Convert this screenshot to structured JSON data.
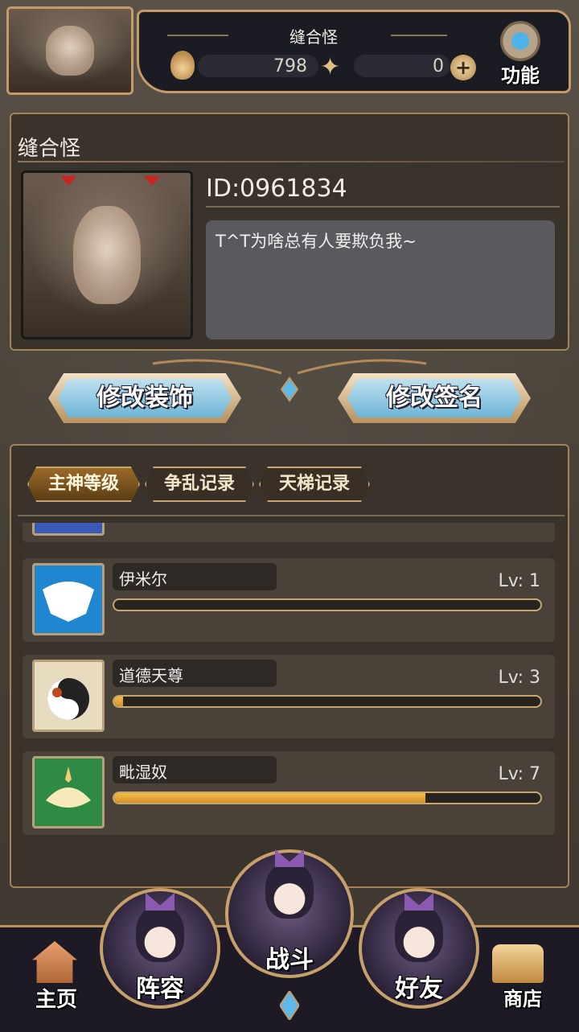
{
  "header": {
    "player_name": "缝合怪",
    "currency_1": "798",
    "currency_2": "0",
    "function_label": "功能"
  },
  "profile": {
    "name": "缝合怪",
    "id_text": "ID:0961834",
    "signature": "T^T为啥总有人要欺负我~"
  },
  "actions": {
    "edit_decoration": "修改装饰",
    "edit_signature": "修改签名"
  },
  "tabs": [
    {
      "label": "主神等级",
      "active": true
    },
    {
      "label": "争乱记录",
      "active": false
    },
    {
      "label": "天梯记录",
      "active": false
    }
  ],
  "gods": [
    {
      "name": "伊米尔",
      "level": "Lv: 1",
      "progress": 0.0,
      "icon": "ymir-ram-icon",
      "icon_color": "#1f86d0"
    },
    {
      "name": "道德天尊",
      "level": "Lv: 3",
      "progress": 0.02,
      "icon": "yin-yang-icon",
      "icon_color": "#e8dcc0"
    },
    {
      "name": "毗湿奴",
      "level": "Lv: 7",
      "progress": 0.73,
      "icon": "lotus-icon",
      "icon_color": "#2f8a46"
    }
  ],
  "nav": {
    "home": "主页",
    "lineup": "阵容",
    "battle": "战斗",
    "friends": "好友",
    "shop": "商店"
  }
}
